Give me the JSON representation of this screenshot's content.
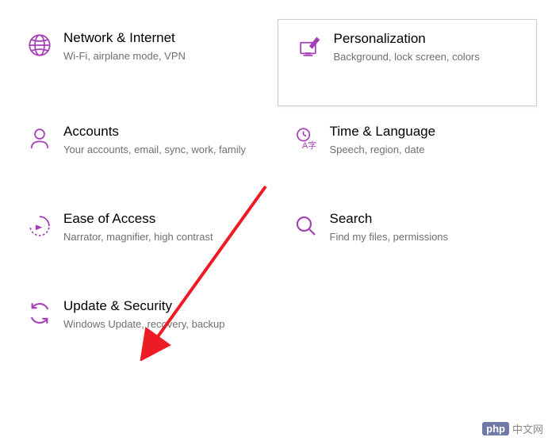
{
  "accent": "#a53db6",
  "tiles": {
    "network": {
      "title": "Network & Internet",
      "desc": "Wi-Fi, airplane mode, VPN"
    },
    "personalization": {
      "title": "Personalization",
      "desc": "Background, lock screen, colors"
    },
    "accounts": {
      "title": "Accounts",
      "desc": "Your accounts, email, sync, work, family"
    },
    "time": {
      "title": "Time & Language",
      "desc": "Speech, region, date"
    },
    "ease": {
      "title": "Ease of Access",
      "desc": "Narrator, magnifier, high contrast"
    },
    "search": {
      "title": "Search",
      "desc": "Find my files, permissions"
    },
    "update": {
      "title": "Update & Security",
      "desc": "Windows Update, recovery, backup"
    }
  },
  "watermark": {
    "badge": "php",
    "text": "中文网"
  }
}
